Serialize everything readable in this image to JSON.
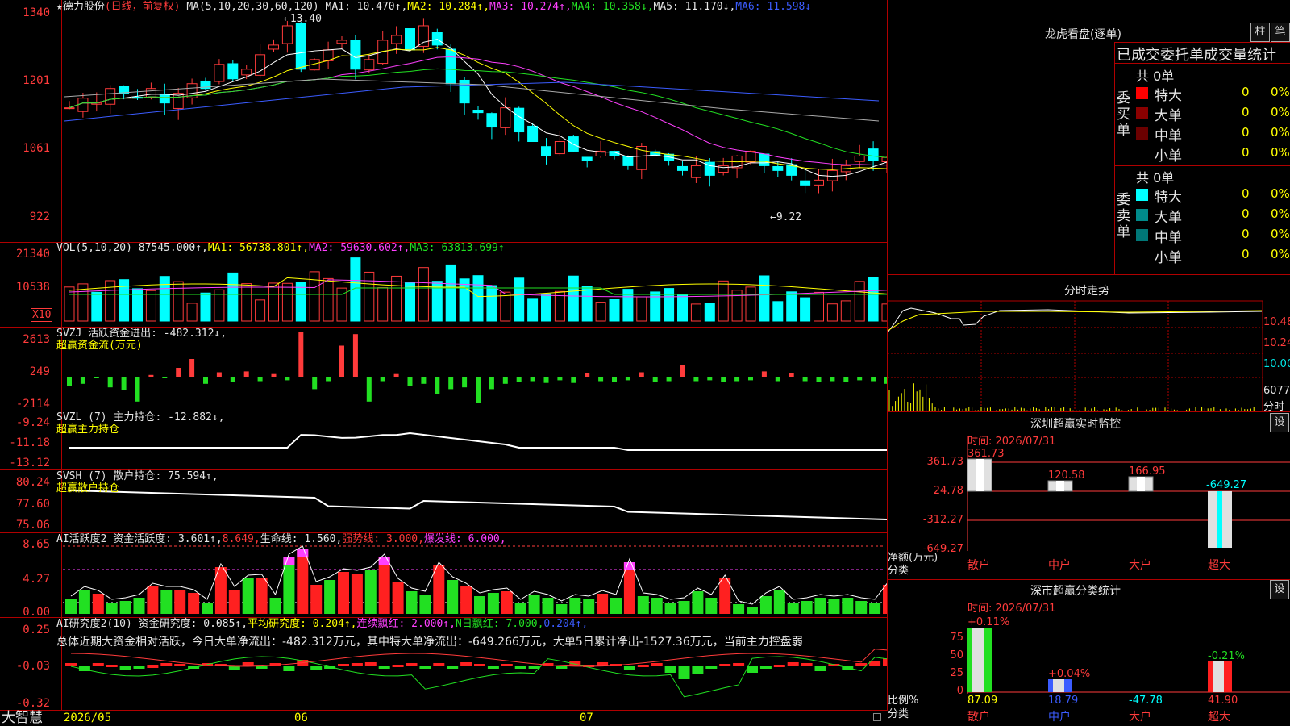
{
  "colors": {
    "up": "#ff3b3b",
    "down": "#00ffff",
    "ma1": "#ffffff",
    "ma2": "#ffff00",
    "ma3": "#ff40ff",
    "ma4": "#22e022",
    "ma5": "#aaaaaa",
    "ma6": "#3b5cff",
    "grid": "#b00000"
  },
  "kline": {
    "title_star": "★",
    "stock": "德力股份",
    "mode": "(日线，前复权)",
    "ma_label": "MA(5,10,20,30,60,120)",
    "ma1": "MA1: 10.470↑,",
    "ma2": "MA2: 10.284↑,",
    "ma3": "MA3: 10.274↑,",
    "ma4": "MA4: 10.358↓,",
    "ma5": "MA5: 11.170↓,",
    "ma6": "MA6: 11.598↓",
    "axis": [
      "1340",
      "1201",
      "1061",
      "922"
    ],
    "high_mark": "13.40",
    "low_mark": "9.22"
  },
  "vol": {
    "label": "VOL(5,10,20)",
    "value": "87545.000↑,",
    "ma1": "MA1: 56738.801↑,",
    "ma2": "MA2: 59630.602↑,",
    "ma3": "MA3: 63813.699↑",
    "axis": [
      "21340",
      "10538"
    ],
    "unit": "X10"
  },
  "svzj": {
    "label": "SVZJ  活跃资金进出: -482.312↓,",
    "sub": "超赢资金流(万元)",
    "axis": [
      "2613",
      "249",
      "-2114"
    ]
  },
  "svzl": {
    "label": "SVZL (7) 主力持仓: -12.882↓,",
    "sub": "超赢主力持仓",
    "axis": [
      "-9.24",
      "-11.18",
      "-13.12"
    ]
  },
  "svsh": {
    "label": "SVSH (7) 散户持仓: 75.594↑,",
    "sub": "超赢散户持仓",
    "axis": [
      "80.24",
      "77.60",
      "75.06"
    ]
  },
  "ai1": {
    "label": "AI活跃度2 资金活跃度: 3.601↑,",
    "v2": "8.649,",
    "v3": "生命线: 1.560,",
    "v4": "强势线: 3.000,",
    "v5": "爆发线: 6.000,",
    "axis": [
      "8.65",
      "4.27",
      "0.00"
    ]
  },
  "ai2": {
    "label": "AI研究度2(10) 资金研究度: 0.085↑,",
    "v2": "平均研究度: 0.204↑,",
    "v3": "连续飘红: 2.000↑,",
    "v4": "N日飘红: 7.000,",
    "v5": "0.204↑,",
    "summary": "总体近期大资金相对活跃，今日大单净流出：-482.312万元，其中特大单净流出：-649.266万元，大单5日累计净出-1527.36万元，当前主力控盘弱",
    "axis": [
      "0.25",
      "-0.03",
      "-0.32"
    ]
  },
  "bottom": {
    "brand": "大智慧",
    "date1": "2026/05",
    "m6": "06",
    "m7": "07"
  },
  "right": {
    "longhu_title": "龙虎看盘(逐单)",
    "btn1": "柱",
    "btn2": "笔",
    "stat_title": "已成交委托单成交量统计",
    "buy_label": "委买单",
    "sell_label": "委卖单",
    "buy_total": "共 0单",
    "sell_total": "共 0单",
    "buy_rows": [
      {
        "name": "特大",
        "v": "0",
        "p": "0%"
      },
      {
        "name": "大单",
        "v": "0",
        "p": "0%"
      },
      {
        "name": "中单",
        "v": "0",
        "p": "0%"
      },
      {
        "name": "小单",
        "v": "0",
        "p": "0%"
      }
    ],
    "sell_rows": [
      {
        "name": "特大",
        "v": "0",
        "p": "0%"
      },
      {
        "name": "大单",
        "v": "0",
        "p": "0%"
      },
      {
        "name": "中单",
        "v": "0",
        "p": "0%"
      },
      {
        "name": "小单",
        "v": "0",
        "p": "0%"
      }
    ],
    "fenshi_title": "分时走势",
    "fenshi_axis": [
      "10.48",
      "10.24",
      "10.00",
      "6077",
      "分时"
    ],
    "sz_title": "深圳超赢实时监控",
    "sz_btn": "设",
    "sz_time": "时间: 2026/07/31",
    "sz_axis": [
      "361.73",
      "24.78",
      "-312.27",
      "-649.27"
    ],
    "sz_unit": "净额(万元)",
    "sz_cat": "分类",
    "sz_bars": [
      {
        "label": "散户",
        "value": "361.73"
      },
      {
        "label": "中户",
        "value": "120.58"
      },
      {
        "label": "大户",
        "value": "166.95"
      },
      {
        "label": "超大",
        "value": "-649.27"
      }
    ],
    "ss_title": "深市超赢分类统计",
    "ss_btn": "设",
    "ss_time": "时间: 2026/07/31",
    "ss_axis": [
      "75",
      "50",
      "25",
      "0"
    ],
    "ss_unit": "比例%",
    "ss_cat": "分类",
    "ss_bars": [
      {
        "label": "散户",
        "pct": "+0.11%",
        "value": "87.09"
      },
      {
        "label": "中户",
        "pct": "+0.04%",
        "value": "18.79"
      },
      {
        "label": "大户",
        "pct": "",
        "value": "-47.78"
      },
      {
        "label": "超大",
        "pct": "-0.21%",
        "value": "41.90"
      }
    ]
  }
}
